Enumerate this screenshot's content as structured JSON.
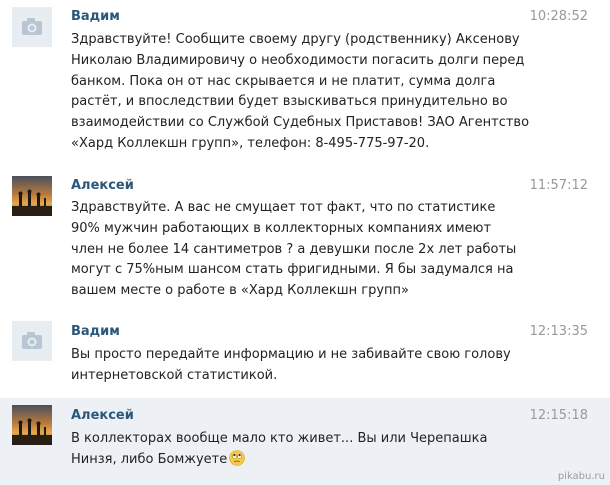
{
  "messages": [
    {
      "author": "Вадим",
      "time": "10:28:52",
      "avatar": "camera-placeholder-icon",
      "lines": [
        "Здравствуйте! Сообщите своему другу (родственнику) Аксенову",
        "Николаю Владимировичу о необходимости погасить долги перед",
        "банком. Пока он от нас скрывается и не платит, сумма долга",
        "растёт, и впоследствии будет взыскиваться принудительно во",
        "взаимодействии со Службой Судебных Приставов! ЗАО Агентство",
        "«Хард Коллекшн групп», телефон: 8-495-775-97-20."
      ]
    },
    {
      "author": "Алексей",
      "time": "11:57:12",
      "avatar": "sunset-photo",
      "lines": [
        "Здравствуйте. А вас не смущает тот факт, что по статистике",
        "90% мужчин работающих в коллекторных компаниях имеют",
        "член не более 14 сантиметров ? а девушки после 2х лет работы",
        "могут с 75%ным шансом стать фригидными. Я бы задумался на",
        "вашем месте о работе в «Хард Коллекшн групп»"
      ]
    },
    {
      "author": "Вадим",
      "time": "12:13:35",
      "avatar": "camera-placeholder-icon",
      "lines": [
        "Вы просто передайте информацию и не забивайте свою голову",
        "интернетовской статистикой."
      ]
    },
    {
      "author": "Алексей",
      "time": "12:15:18",
      "avatar": "sunset-photo",
      "lines": [
        "В коллекторах вообще мало кто живет... Вы или Черепашка",
        "Нинзя, либо Бомжуете"
      ],
      "emoji": "rolling-eyes-emoji-icon"
    }
  ],
  "watermark": "pikabu.ru",
  "colors": {
    "author": "#2b587a",
    "time": "#999999",
    "text": "#222222",
    "highlight_bg": "#edf1f5",
    "placeholder_bg": "#e8edf2"
  }
}
